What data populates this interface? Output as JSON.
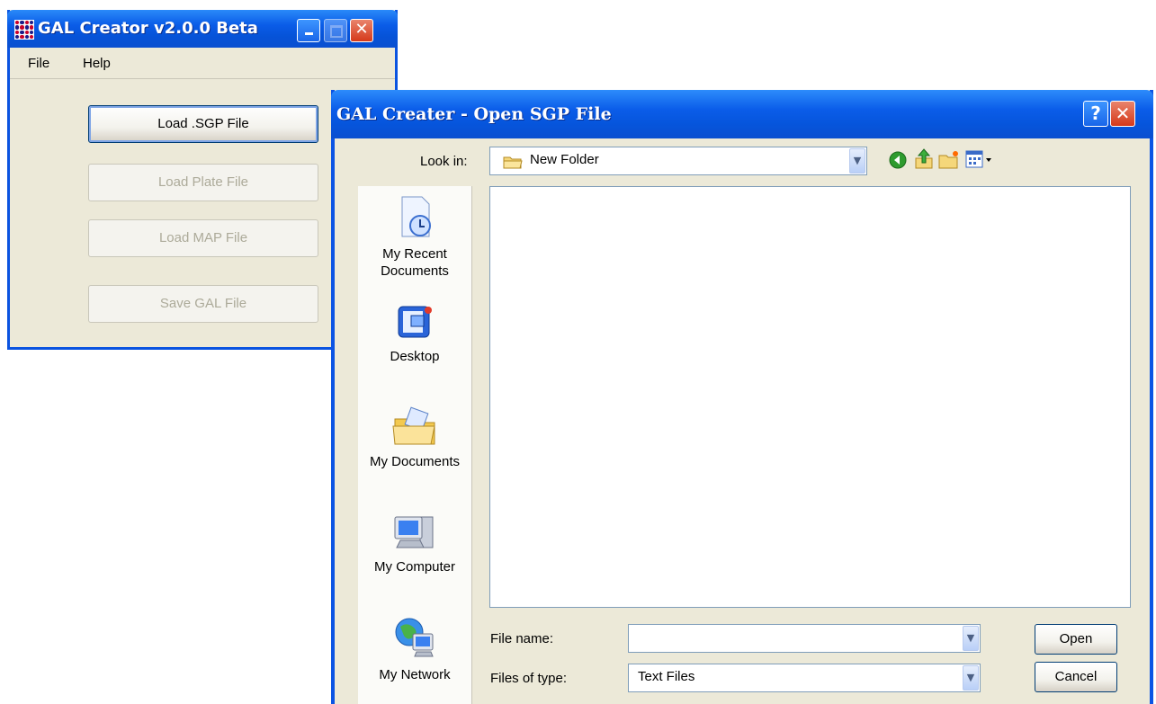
{
  "main_window": {
    "title": "GAL Creator v2.0.0 Beta",
    "menu": [
      "File",
      "Help"
    ],
    "buttons": [
      {
        "label": "Load .SGP File",
        "enabled": true
      },
      {
        "label": "Load Plate File",
        "enabled": false
      },
      {
        "label": "Load MAP File",
        "enabled": false
      },
      {
        "label": "Save GAL File",
        "enabled": false
      }
    ]
  },
  "dialog": {
    "title": "GAL Creater - Open SGP File",
    "help_symbol": "?",
    "look_in_label": "Look in:",
    "look_in_value": "New Folder",
    "places": [
      "My Recent\nDocuments",
      "Desktop",
      "My Documents",
      "My Computer",
      "My Network"
    ],
    "file_name_label": "File name:",
    "file_name_value": "",
    "files_of_type_label": "Files of type:",
    "files_of_type_value": "Text Files",
    "open_label": "Open",
    "cancel_label": "Cancel"
  },
  "icons": {
    "title_close": "close-icon",
    "back": "back-icon",
    "up": "up-folder-icon",
    "new_folder": "new-folder-icon",
    "views": "views-menu-icon"
  }
}
